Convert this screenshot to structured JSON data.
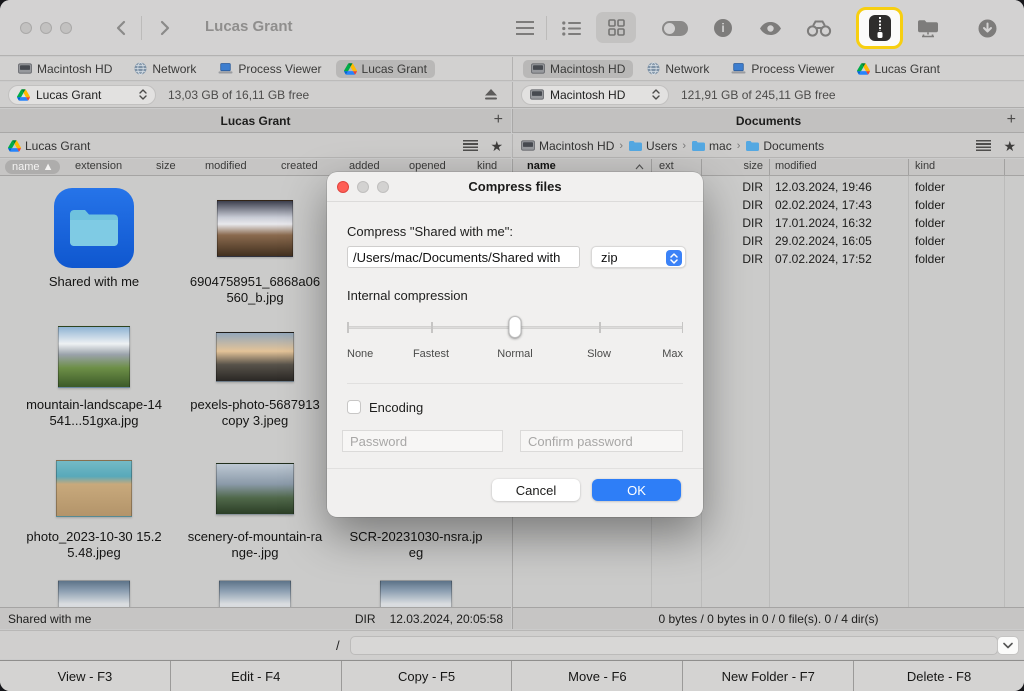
{
  "window": {
    "title": "Lucas Grant"
  },
  "toolbar": {
    "icons": [
      "back",
      "forward",
      "menu",
      "list-view",
      "grid-view",
      "toggle",
      "info",
      "preview-eye",
      "search-binoculars",
      "compress-zip",
      "network-folder",
      "downloads"
    ],
    "highlighted_icon": "compress-zip"
  },
  "left_pane": {
    "tabs": [
      {
        "label": "Macintosh HD",
        "icon": "internal-drive"
      },
      {
        "label": "Network",
        "icon": "globe"
      },
      {
        "label": "Process Viewer",
        "icon": "laptop"
      },
      {
        "label": "Lucas Grant",
        "icon": "google-drive",
        "active": true
      }
    ],
    "drive": {
      "name": "Lucas Grant",
      "free": "13,03 GB of 16,11 GB free"
    },
    "title": "Lucas Grant",
    "breadcrumb": [
      {
        "label": "Lucas Grant",
        "icon": "google-drive"
      }
    ],
    "columns": [
      "name",
      "extension",
      "size",
      "modified",
      "created",
      "added",
      "opened",
      "kind"
    ],
    "sort_column": "name",
    "files": [
      {
        "name": "Shared with me",
        "type": "folder",
        "selected": true
      },
      {
        "name": "6904758951_6868a06560_b.jpg",
        "type": "image"
      },
      {
        "name": "mountain-landscape-14541...51gxa.jpg",
        "type": "image"
      },
      {
        "name": "pexels-photo-5687913 copy 3.jpeg",
        "type": "image"
      },
      {
        "name": "photo_2023-10-30 15.25.48.jpeg",
        "type": "image"
      },
      {
        "name": "scenery-of-mountain-range-.jpg",
        "type": "image"
      },
      {
        "name": "SCR-20231030-nsra.jpeg",
        "type": "image"
      }
    ],
    "status": {
      "item": "Shared with me",
      "size": "DIR",
      "modified": "12.03.2024, 20:05:58"
    }
  },
  "right_pane": {
    "tabs": [
      {
        "label": "Macintosh HD",
        "icon": "internal-drive",
        "active": true
      },
      {
        "label": "Network",
        "icon": "globe"
      },
      {
        "label": "Process Viewer",
        "icon": "laptop"
      },
      {
        "label": "Lucas Grant",
        "icon": "google-drive"
      }
    ],
    "drive": {
      "name": "Macintosh HD",
      "free": "121,91 GB of 245,11 GB free"
    },
    "title": "Documents",
    "breadcrumb": [
      {
        "label": "Macintosh HD",
        "icon": "internal-drive"
      },
      {
        "label": "Users",
        "icon": "folder"
      },
      {
        "label": "mac",
        "icon": "folder"
      },
      {
        "label": "Documents",
        "icon": "folder"
      }
    ],
    "columns": [
      "name",
      "ext",
      "size",
      "modified",
      "kind"
    ],
    "sort_column": "name",
    "rows": [
      {
        "size": "DIR",
        "modified": "12.03.2024, 19:46",
        "kind": "folder"
      },
      {
        "size": "DIR",
        "modified": "02.02.2024, 17:43",
        "kind": "folder"
      },
      {
        "size": "DIR",
        "modified": "17.01.2024, 16:32",
        "kind": "folder"
      },
      {
        "size": "DIR",
        "modified": "29.02.2024, 16:05",
        "kind": "folder"
      },
      {
        "size": "DIR",
        "modified": "07.02.2024, 17:52",
        "kind": "folder"
      }
    ],
    "status": "0 bytes / 0 bytes in 0 / 0 file(s). 0 / 4 dir(s)"
  },
  "dialog": {
    "title": "Compress files",
    "compress_label": "Compress \"Shared with me\":",
    "path_value": "/Users/mac/Documents/Shared with",
    "format_value": "zip",
    "compression_label": "Internal compression",
    "slider_labels": [
      "None",
      "Fastest",
      "Normal",
      "Slow",
      "Max"
    ],
    "slider_value": "Normal",
    "encoding_label": "Encoding",
    "encoding_checked": false,
    "password_placeholder": "Password",
    "confirm_placeholder": "Confirm password",
    "cancel_label": "Cancel",
    "ok_label": "OK"
  },
  "path_bar": {
    "prefix": "/",
    "value": ""
  },
  "function_bar": {
    "buttons": [
      {
        "label": "View - F3"
      },
      {
        "label": "Edit - F4"
      },
      {
        "label": "Copy - F5"
      },
      {
        "label": "Move - F6"
      },
      {
        "label": "New Folder - F7"
      },
      {
        "label": "Delete - F8"
      }
    ]
  },
  "colors": {
    "accent_blue": "#2e7ef7",
    "highlight_yellow": "#f7cf11",
    "ok_button": "#2e7ef7"
  }
}
